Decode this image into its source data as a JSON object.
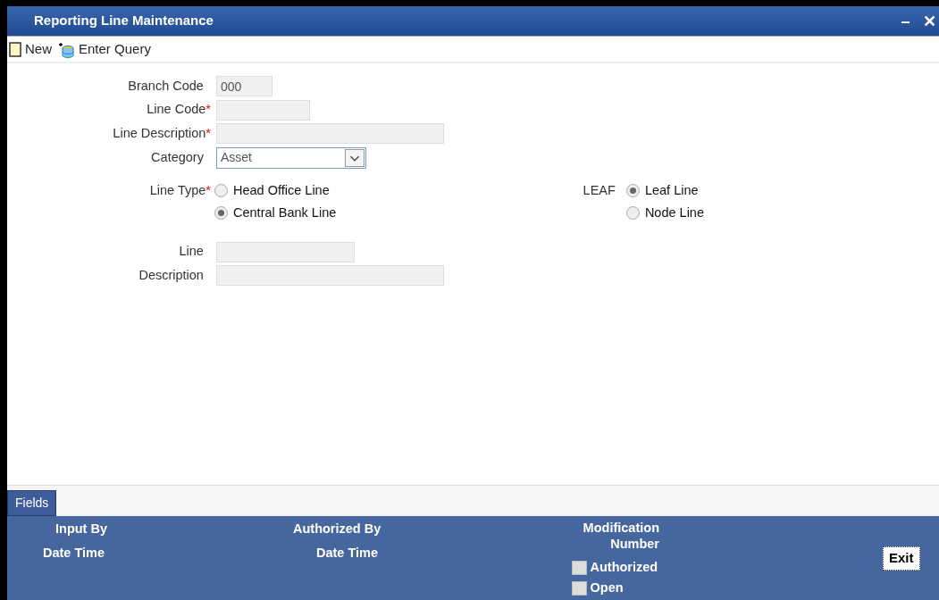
{
  "window": {
    "title": "Reporting Line Maintenance",
    "controls": [
      "–",
      "✕"
    ]
  },
  "toolbar": [
    {
      "kind": "new",
      "label": "New"
    },
    {
      "kind": "query",
      "label": "Enter Query"
    }
  ],
  "fields": [
    {
      "label": "Branch Code",
      "value": "000"
    },
    {
      "label": "Line Code",
      "marker": "*"
    },
    {
      "label": "Line Description",
      "marker": "*"
    }
  ],
  "category": {
    "label": "Category",
    "value": "Asset"
  },
  "line_type": {
    "label": "Line Type",
    "marker": "*",
    "options": [
      {
        "label": "Head Office Line",
        "selected": false
      },
      {
        "label": "Central Bank Line",
        "selected": true
      }
    ]
  },
  "leaf": {
    "label": "LEAF",
    "options": [
      {
        "label": "Leaf Line",
        "selected": true
      },
      {
        "label": "Node Line",
        "selected": false
      }
    ]
  },
  "parent_fields": [
    {
      "label": "Line"
    },
    {
      "label": "Description"
    }
  ],
  "footer": {
    "tab": "Fields",
    "input_by": "Input By",
    "input_date": "Date Time",
    "authorized_by": "Authorized By",
    "auth_date": "Date Time",
    "modification": "Modification Number",
    "checks": [
      {
        "label": "Authorized",
        "checked": false
      },
      {
        "label": "Open",
        "checked": false
      }
    ],
    "exit": "Exit"
  }
}
